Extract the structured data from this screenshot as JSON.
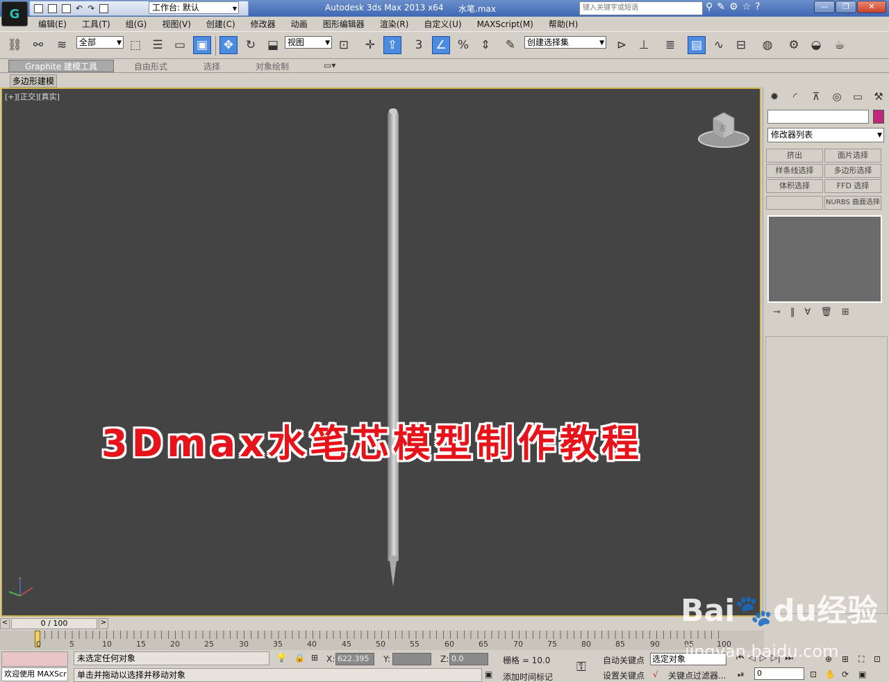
{
  "app": {
    "title": "Autodesk 3ds Max  2013 x64",
    "file": "水笔.max",
    "workspace": "工作台: 默认",
    "search_placeholder": "键入关键字或短语"
  },
  "menu": [
    "编辑(E)",
    "工具(T)",
    "组(G)",
    "视图(V)",
    "创建(C)",
    "修改器",
    "动画",
    "图形编辑器",
    "渲染(R)",
    "自定义(U)",
    "MAXScript(M)",
    "帮助(H)"
  ],
  "toolbar": {
    "selection_filter": "全部",
    "ref_coord": "视图",
    "named_selection": "创建选择集"
  },
  "ribbon": {
    "tabs": [
      "Graphite 建模工具",
      "自由形式",
      "选择",
      "对象绘制"
    ],
    "sub": "多边形建模"
  },
  "viewport": {
    "label": "[+][正交][真实]",
    "overlay_title": "3Dmax水笔芯模型制作教程",
    "cube_label": "左"
  },
  "command_panel": {
    "modifier_list": "修改器列表",
    "buttons": [
      "挤出",
      "面片选择",
      "样条线选择",
      "多边形选择",
      "体积选择",
      "FFD 选择",
      "",
      "NURBS 曲面选择"
    ],
    "color": "#c0267a"
  },
  "timeline": {
    "frame_display": "0 / 100",
    "ticks": [
      "0",
      "5",
      "10",
      "15",
      "20",
      "25",
      "30",
      "35",
      "40",
      "45",
      "50",
      "55",
      "60",
      "65",
      "70",
      "75",
      "80",
      "85",
      "90",
      "95",
      "100"
    ]
  },
  "status": {
    "welcome": "欢迎使用 MAXScr",
    "selection": "未选定任何对象",
    "prompt": "单击并拖动以选择并移动对象",
    "x_label": "X:",
    "x_value": "622.395",
    "y_label": "Y:",
    "y_value": "",
    "z_label": "Z:",
    "z_value": "0.0",
    "grid": "栅格 = 10.0",
    "add_time_tag": "添加时间标记",
    "auto_key": "自动关键点",
    "set_key": "设置关键点",
    "selected_object": "选定对象",
    "key_filters": "关键点过滤器...",
    "frame": "0"
  },
  "watermark": {
    "brand": "Bai",
    "brand_mid": "du",
    "brand_cn": "经验",
    "url": "jingyan.baidu.com"
  }
}
